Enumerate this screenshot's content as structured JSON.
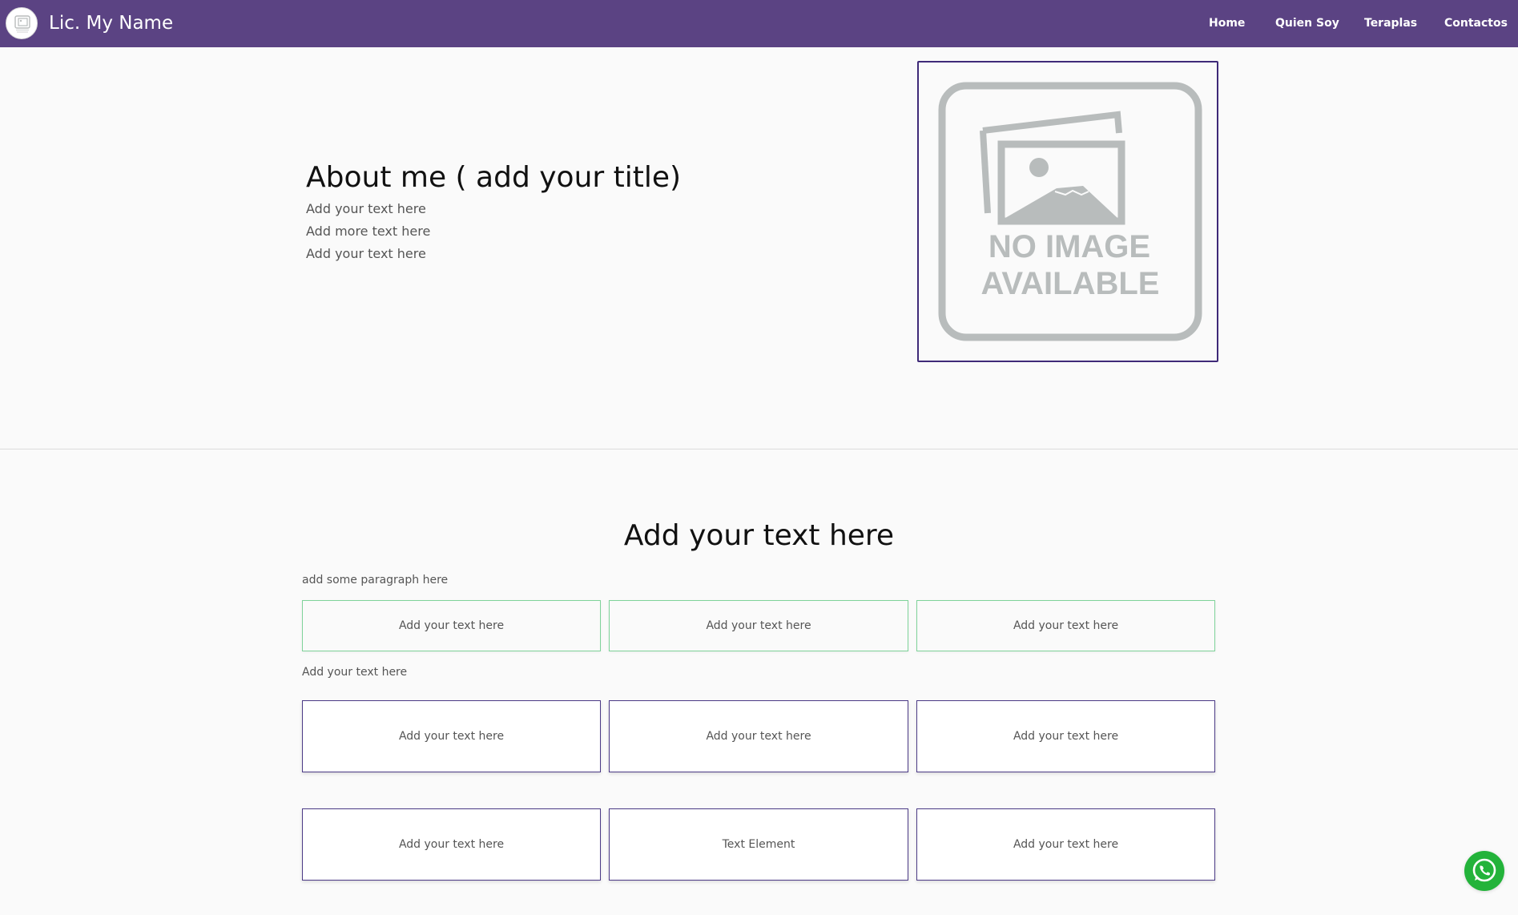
{
  "navbar": {
    "brand": "Lic. My Name",
    "logo": "no-image-logo",
    "links": [
      "Home",
      "Quien Soy",
      "Teraplas",
      "Contactos"
    ],
    "background": "#5b4383"
  },
  "about": {
    "title": "About me  ( add your title)",
    "lines": [
      "Add your  text here",
      "Add more text here",
      "Add your text here"
    ],
    "image": {
      "line1": "NO IMAGE",
      "line2": "AVAILABLE"
    }
  },
  "section": {
    "title": "Add your text here",
    "paragraph": "add some paragraph here",
    "green_cards": [
      "Add your text here",
      "Add your text here",
      "Add your text here"
    ],
    "subheading": "Add your text here",
    "purple_row1": [
      "Add your text here",
      "Add your text here",
      "Add your text here"
    ],
    "purple_row2": [
      "Add your text here",
      "Text Element",
      "Add your text here"
    ]
  },
  "floating": {
    "whatsapp_icon": "whatsapp-icon",
    "color": "#23b33a"
  }
}
